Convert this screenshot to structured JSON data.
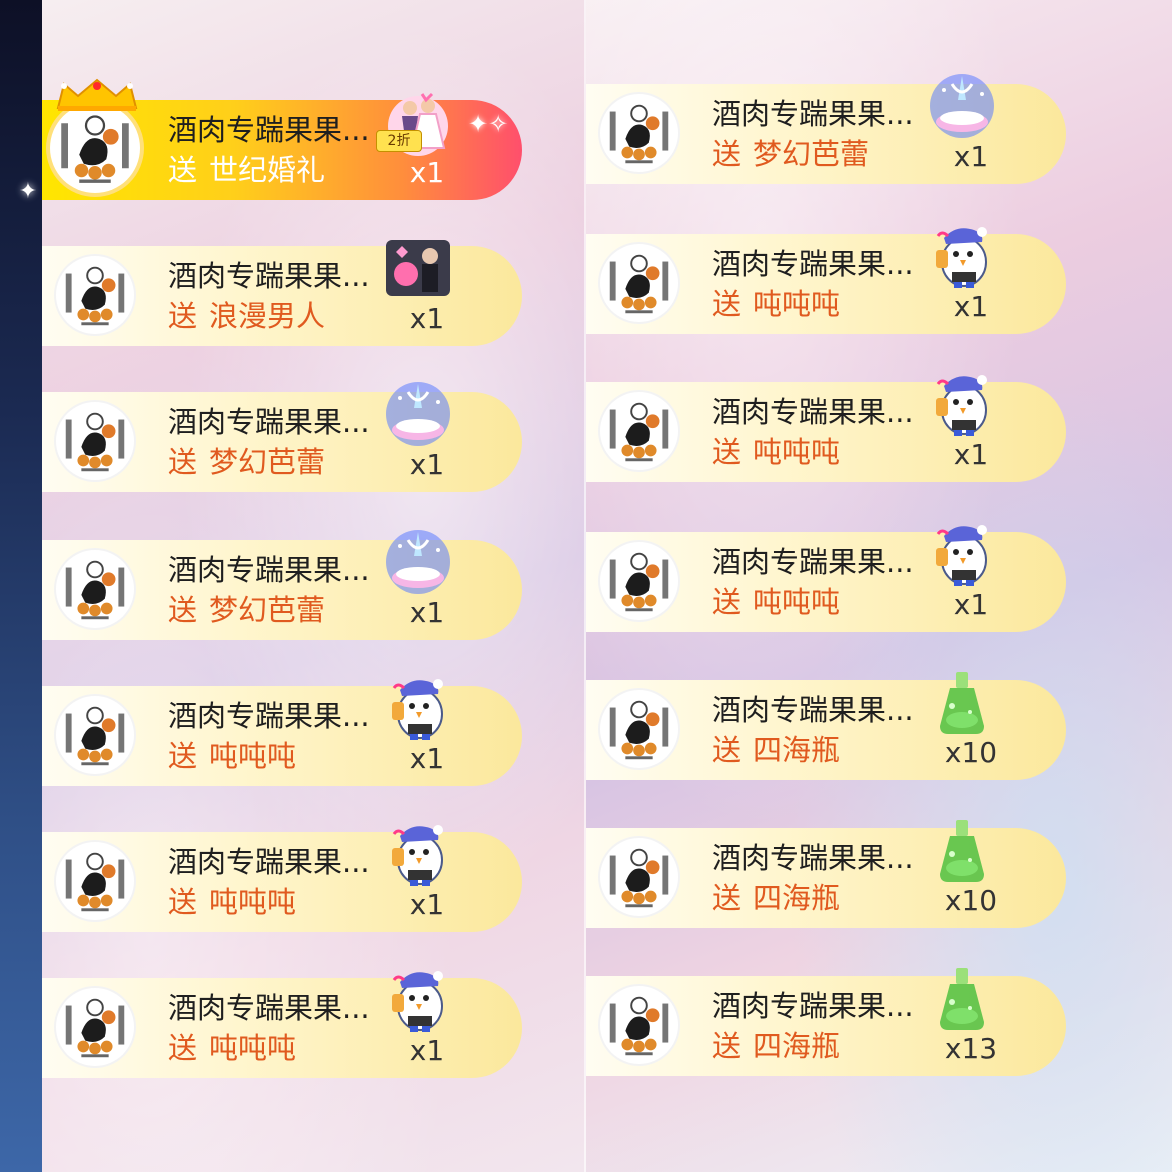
{
  "left_column": [
    {
      "name": "酒肉专踹果果...",
      "send": "送",
      "gift": "世纪婚礼",
      "count": "x1",
      "featured": true,
      "discount": "2折",
      "icon": "wedding-couple-icon"
    },
    {
      "name": "酒肉专踹果果...",
      "send": "送",
      "gift": "浪漫男人",
      "count": "x1",
      "icon": "romantic-man-icon"
    },
    {
      "name": "酒肉专踹果果...",
      "send": "送",
      "gift": "梦幻芭蕾",
      "count": "x1",
      "icon": "dream-ballet-icon"
    },
    {
      "name": "酒肉专踹果果...",
      "send": "送",
      "gift": "梦幻芭蕾",
      "count": "x1",
      "icon": "dream-ballet-icon"
    },
    {
      "name": "酒肉专踹果果...",
      "send": "送",
      "gift": "吨吨吨",
      "count": "x1",
      "icon": "penguin-drink-icon"
    },
    {
      "name": "酒肉专踹果果...",
      "send": "送",
      "gift": "吨吨吨",
      "count": "x1",
      "icon": "penguin-drink-icon"
    },
    {
      "name": "酒肉专踹果果...",
      "send": "送",
      "gift": "吨吨吨",
      "count": "x1",
      "icon": "penguin-drink-icon"
    }
  ],
  "right_column": [
    {
      "name": "酒肉专踹果果...",
      "send": "送",
      "gift": "梦幻芭蕾",
      "count": "x1",
      "icon": "dream-ballet-icon"
    },
    {
      "name": "酒肉专踹果果...",
      "send": "送",
      "gift": "吨吨吨",
      "count": "x1",
      "icon": "penguin-drink-icon"
    },
    {
      "name": "酒肉专踹果果...",
      "send": "送",
      "gift": "吨吨吨",
      "count": "x1",
      "icon": "penguin-drink-icon"
    },
    {
      "name": "酒肉专踹果果...",
      "send": "送",
      "gift": "吨吨吨",
      "count": "x1",
      "icon": "penguin-drink-icon"
    },
    {
      "name": "酒肉专踹果果...",
      "send": "送",
      "gift": "四海瓶",
      "count": "x10",
      "icon": "green-bottle-icon"
    },
    {
      "name": "酒肉专踹果果...",
      "send": "送",
      "gift": "四海瓶",
      "count": "x10",
      "icon": "green-bottle-icon"
    },
    {
      "name": "酒肉专踹果果...",
      "send": "送",
      "gift": "四海瓶",
      "count": "x13",
      "icon": "green-bottle-icon"
    }
  ],
  "colors": {
    "gift_text": "#e05a1f",
    "name_text": "#1f1f1f",
    "item_bg_end": "#fbe89c",
    "featured_bg_start": "#ffe600",
    "featured_bg_end": "#ff4f6c"
  }
}
